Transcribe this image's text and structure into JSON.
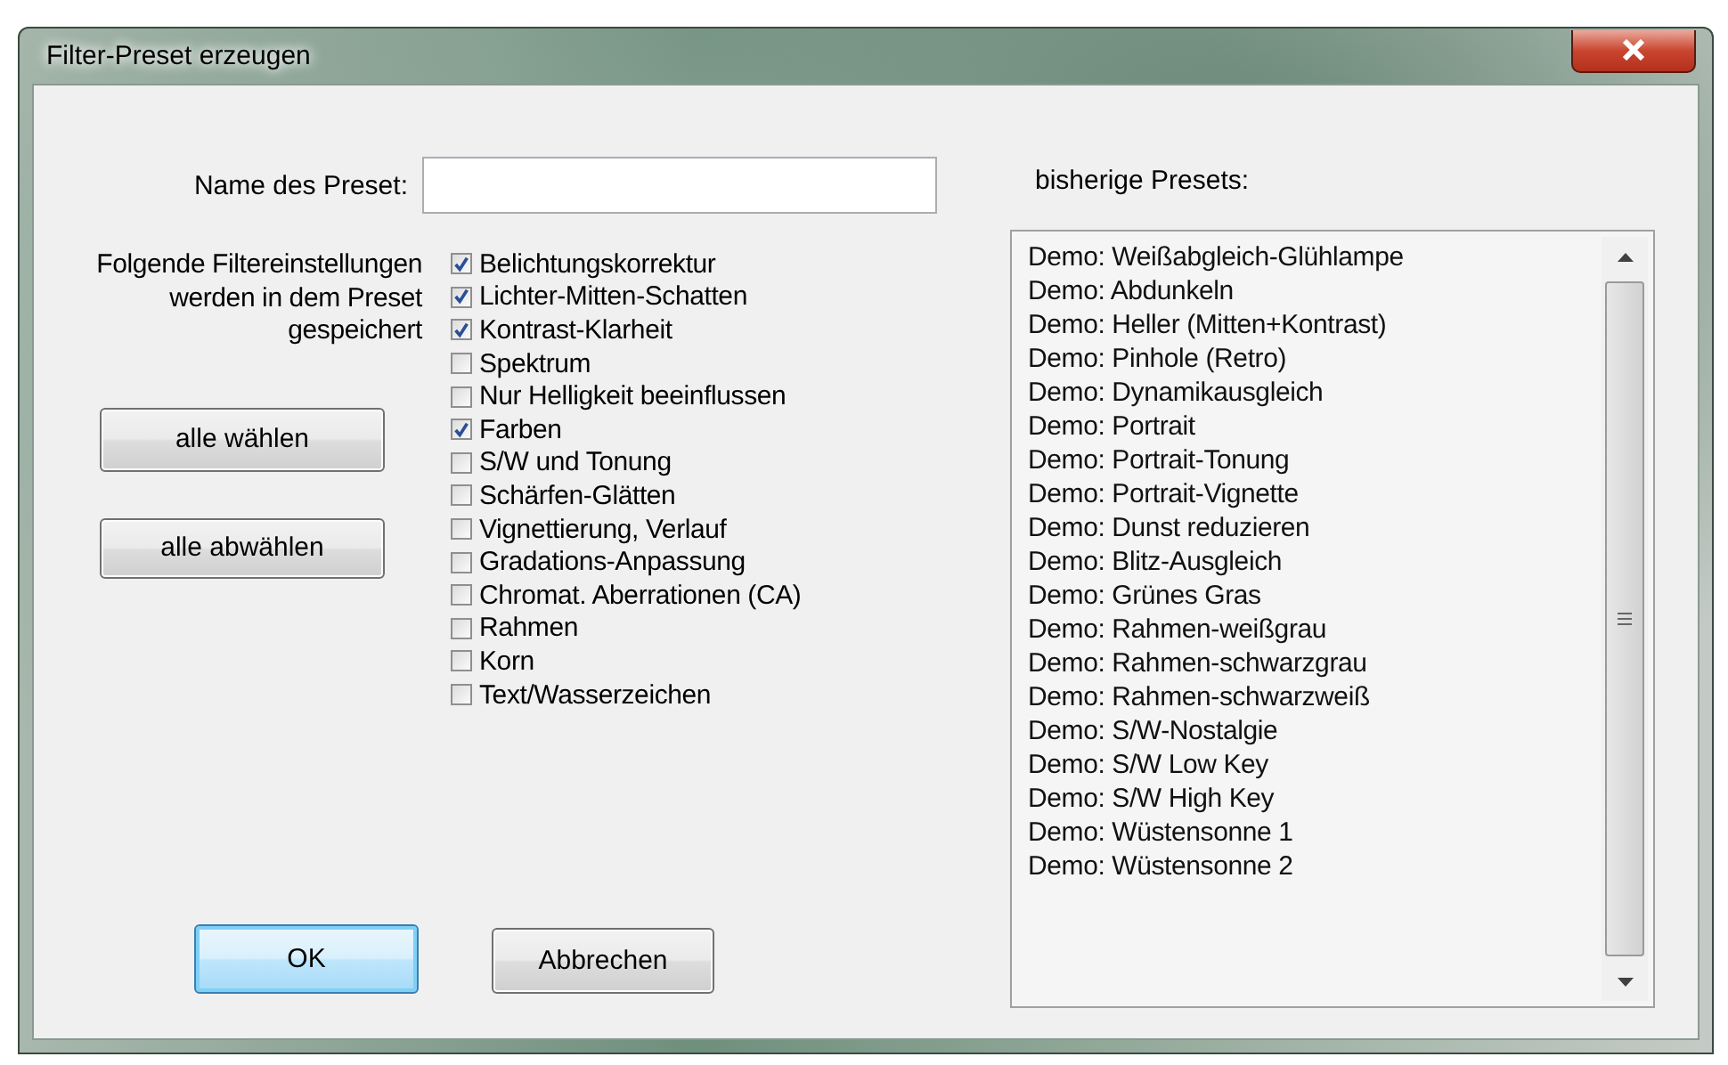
{
  "window": {
    "title": "Filter-Preset erzeugen"
  },
  "name_field": {
    "label": "Name des Preset:"
  },
  "filters_label": "Folgende Filtereinstellungen werden in dem Preset gespeichert",
  "filters": [
    {
      "label": "Belichtungskorrektur",
      "checked": true
    },
    {
      "label": "Lichter-Mitten-Schatten",
      "checked": true
    },
    {
      "label": "Kontrast-Klarheit",
      "checked": true
    },
    {
      "label": "Spektrum",
      "checked": false
    },
    {
      "label": "Nur Helligkeit beeinflussen",
      "checked": false
    },
    {
      "label": "Farben",
      "checked": true
    },
    {
      "label": "S/W und Tonung",
      "checked": false
    },
    {
      "label": "Schärfen-Glätten",
      "checked": false
    },
    {
      "label": "Vignettierung, Verlauf",
      "checked": false
    },
    {
      "label": "Gradations-Anpassung",
      "checked": false
    },
    {
      "label": "Chromat. Aberrationen (CA)",
      "checked": false
    },
    {
      "label": "Rahmen",
      "checked": false
    },
    {
      "label": "Korn",
      "checked": false
    },
    {
      "label": "Text/Wasserzeichen",
      "checked": false
    }
  ],
  "buttons": {
    "select_all": "alle wählen",
    "deselect_all": "alle abwählen",
    "ok": "OK",
    "cancel": "Abbrechen"
  },
  "presets": {
    "label": "bisherige Presets:",
    "items": [
      "Demo: Weißabgleich-Glühlampe",
      "Demo: Abdunkeln",
      "Demo: Heller (Mitten+Kontrast)",
      "Demo: Pinhole (Retro)",
      "Demo: Dynamikausgleich",
      "Demo: Portrait",
      "Demo: Portrait-Tonung",
      "Demo: Portrait-Vignette",
      "Demo: Dunst reduzieren",
      "Demo: Blitz-Ausgleich",
      "Demo: Grünes Gras",
      "Demo: Rahmen-weißgrau",
      "Demo: Rahmen-schwarzgrau",
      "Demo: Rahmen-schwarzweiß",
      "Demo: S/W-Nostalgie",
      "Demo: S/W Low Key",
      "Demo: S/W High Key",
      "Demo: Wüstensonne 1",
      "Demo: Wüstensonne 2"
    ]
  }
}
